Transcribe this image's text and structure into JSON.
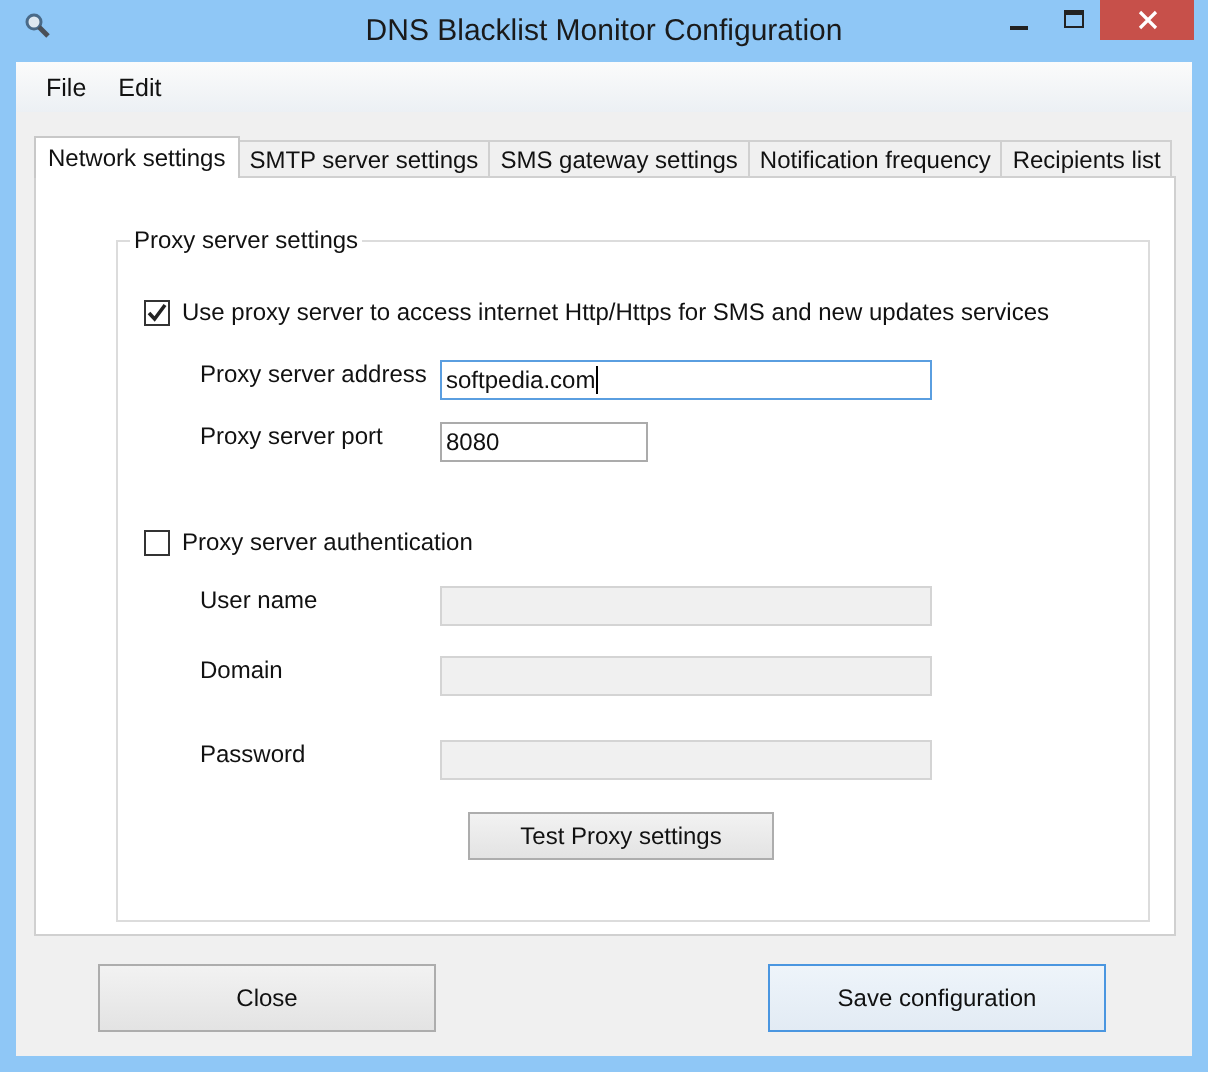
{
  "window": {
    "title": "DNS Blacklist Monitor Configuration"
  },
  "menu": [
    "File",
    "Edit"
  ],
  "tabs": [
    {
      "label": "Network settings",
      "selected": true
    },
    {
      "label": "SMTP server settings",
      "selected": false
    },
    {
      "label": "SMS gateway settings",
      "selected": false
    },
    {
      "label": "Notification frequency",
      "selected": false
    },
    {
      "label": "Recipients list",
      "selected": false
    }
  ],
  "group": {
    "title": "Proxy server settings",
    "use_proxy": {
      "label": "Use proxy server to access internet Http/Https for SMS and new updates services",
      "checked": true
    },
    "address": {
      "label": "Proxy server address",
      "value": "softpedia.com"
    },
    "port": {
      "label": "Proxy server port",
      "value": "8080"
    },
    "auth": {
      "label": "Proxy server authentication",
      "checked": false
    },
    "auth_fields": [
      {
        "label": "User name",
        "disabled": true
      },
      {
        "label": "Domain",
        "disabled": true
      },
      {
        "label": "Password",
        "disabled": true
      }
    ],
    "test_button": "Test Proxy settings"
  },
  "buttons": [
    {
      "label": "Close",
      "focused": false
    },
    {
      "label": "Save configuration",
      "focused": true
    }
  ]
}
